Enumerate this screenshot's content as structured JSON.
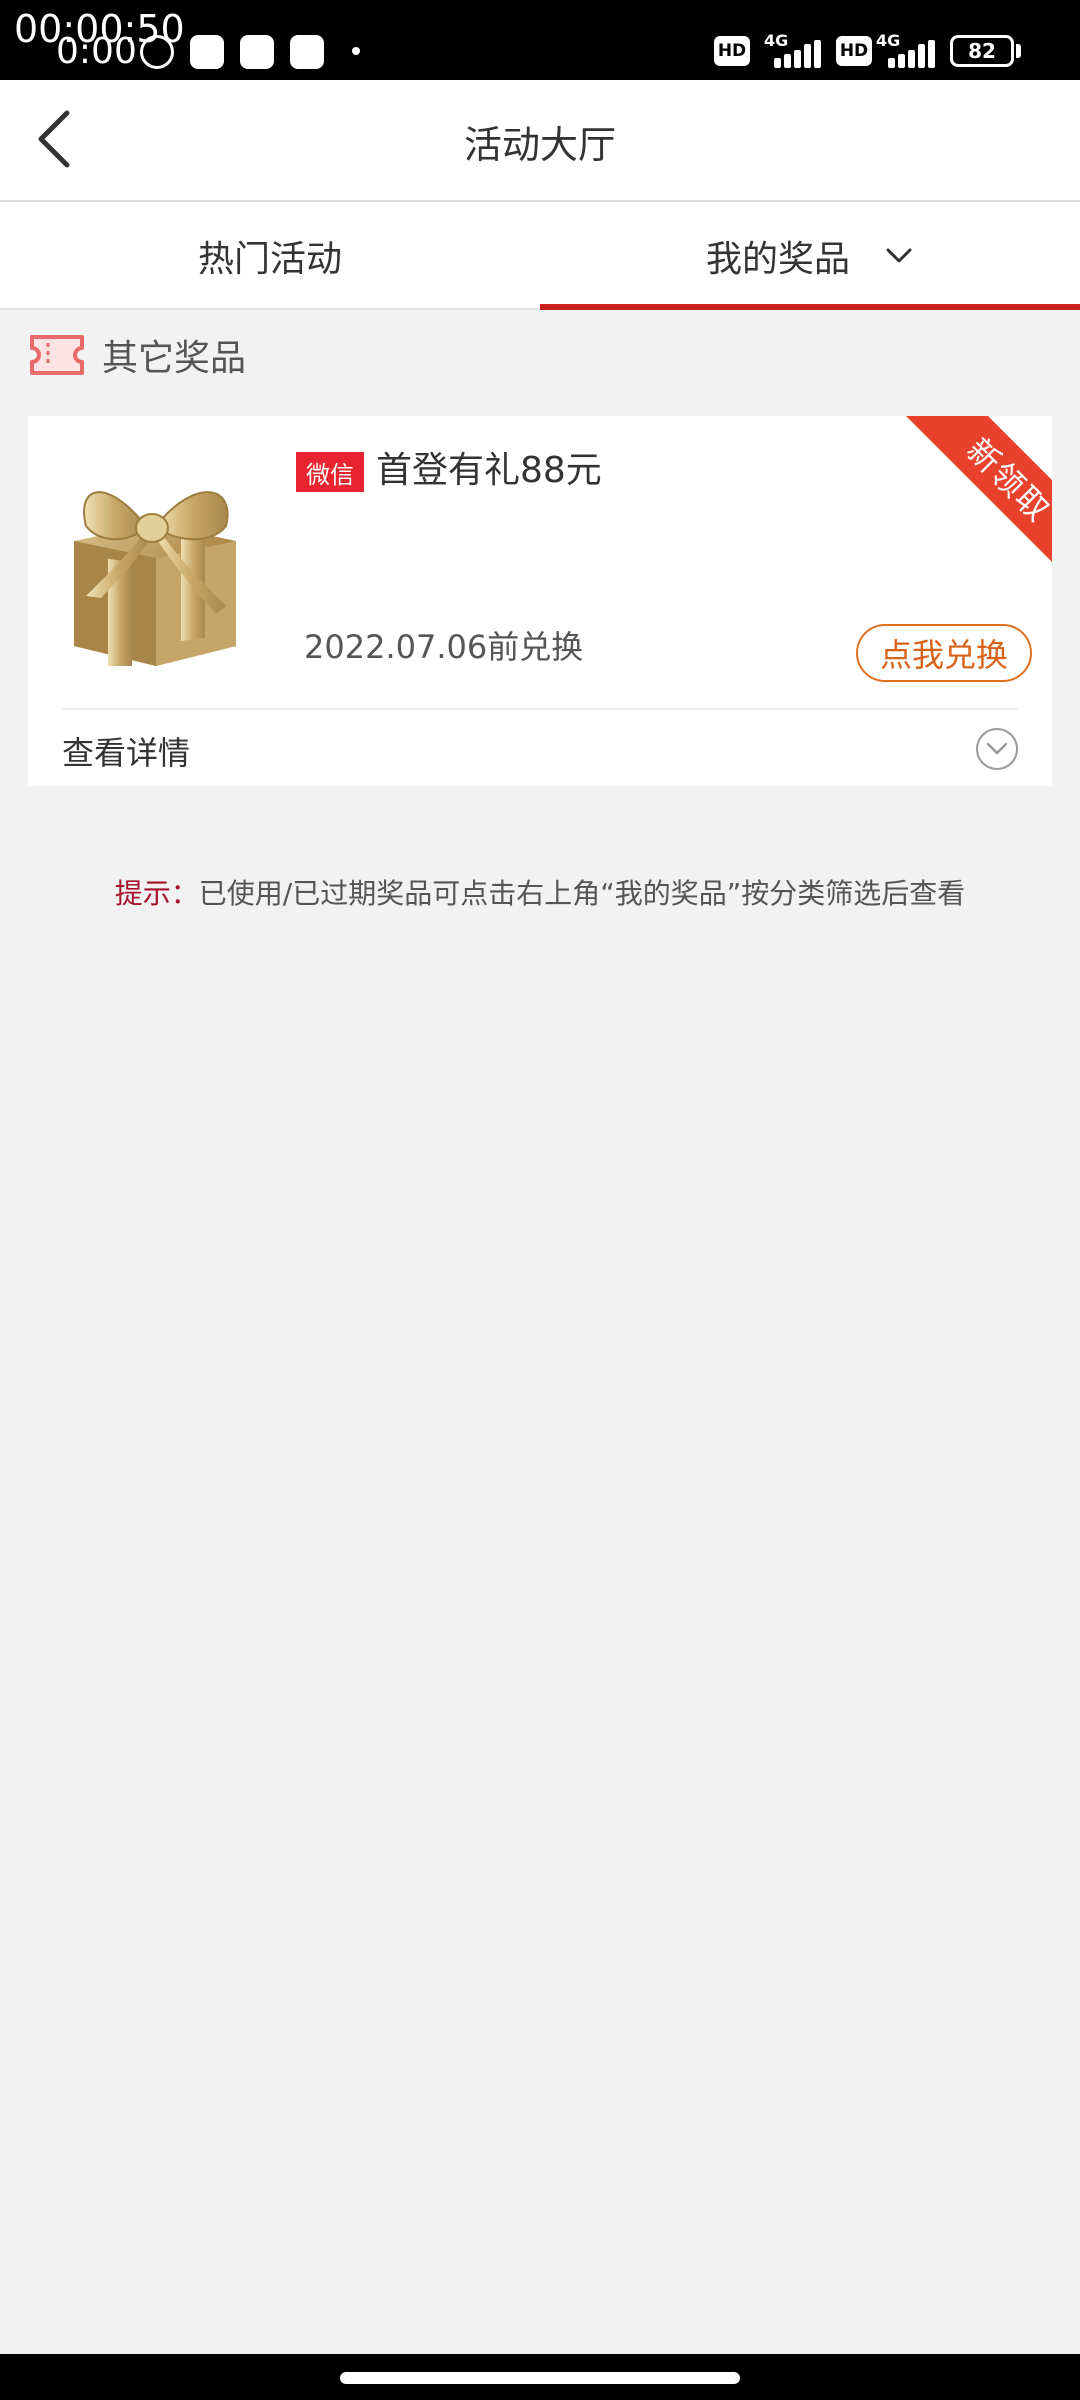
{
  "status_bar": {
    "time_overlay": "00:00:50",
    "time": "0:00",
    "net_label_1": "4G",
    "net_label_2": "4G",
    "hd_label_1": "HD",
    "hd_label_2": "HD",
    "battery": "82"
  },
  "header": {
    "title": "活动大厅",
    "back_icon": "chevron-left-icon"
  },
  "tabs": [
    {
      "label": "热门活动",
      "active": false
    },
    {
      "label": "我的奖品",
      "active": true
    }
  ],
  "section": {
    "title": "其它奖品",
    "icon": "ticket-icon"
  },
  "prize": {
    "source_badge": "微信",
    "title": "首登有礼88元",
    "ribbon": "新领取",
    "expire": "2022.07.06前兑换",
    "redeem_label": "点我兑换",
    "details_label": "查看详情"
  },
  "tip": {
    "label": "提示：",
    "text": "已使用/已过期奖品可点击右上角“我的奖品”按分类筛选后查看"
  },
  "colors": {
    "accent_red": "#c91f1f",
    "badge_red": "#e8242f",
    "redeem_orange": "#e0701e",
    "tip_label": "#a5122a"
  }
}
